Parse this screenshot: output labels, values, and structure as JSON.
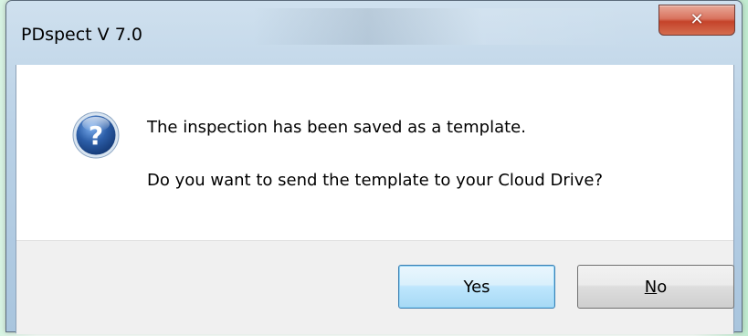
{
  "window": {
    "title": "PDspect V 7.0",
    "close_symbol": "✕"
  },
  "message": {
    "icon": "question-icon",
    "line1": "The inspection has been saved as a template.",
    "line2": "Do you want to send the template to your Cloud Drive?"
  },
  "buttons": {
    "yes_label": "Yes",
    "no_label": "No",
    "no_accelerator": "N"
  },
  "colors": {
    "titlebar": "#b9d1e6",
    "close_button": "#c5432a",
    "default_button_border": "#3c7fb1",
    "question_icon": "#2c5ea8"
  }
}
